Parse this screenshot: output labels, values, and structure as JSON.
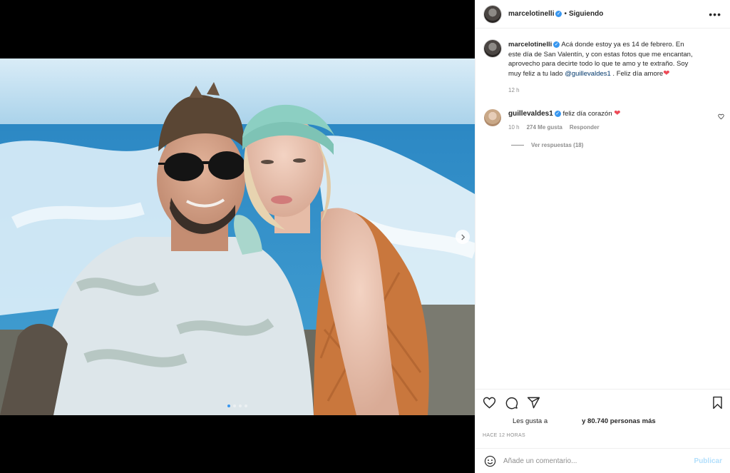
{
  "post": {
    "author": "marcelotinelli",
    "follow_status": "Siguiendo",
    "separator": "•",
    "more_icon": "•••",
    "verified_glyph": "✓",
    "caption_text": " Acá donde estoy ya es 14 de febrero. En este día de San Valentín, y con estas fotos que me encantan, aprovecho para decirte todo lo que te amo y te extraño. Soy muy feliz a tu lado ",
    "caption_mention": "@guillevaldes1",
    "caption_end": " . Feliz día amore",
    "caption_emoji": "❤",
    "caption_time": "12 h"
  },
  "comment": {
    "author": "guillevaldes1",
    "text": " feliz día corazón ",
    "emoji": "❤",
    "time": "10 h",
    "likes": "274 Me gusta",
    "reply": "Responder",
    "view_replies": "Ver respuestas (18)"
  },
  "engagement": {
    "likes_prefix": "Les gusta a",
    "likes_rest": "y 80.740 personas más",
    "posted_ago": "HACE 12 HORAS"
  },
  "composer": {
    "placeholder": "Añade un comentario...",
    "publish": "Publicar"
  },
  "carousel": {
    "slides": 4,
    "active_index": 0
  },
  "colors": {
    "accent": "#3897f0",
    "heart": "#ed4956",
    "link": "#00376b",
    "muted": "#8e8e8e"
  },
  "icons": [
    "more-options-icon",
    "verified-icon",
    "heart-icon",
    "comment-icon",
    "share-icon",
    "bookmark-icon",
    "emoji-icon",
    "chevron-right-icon"
  ]
}
